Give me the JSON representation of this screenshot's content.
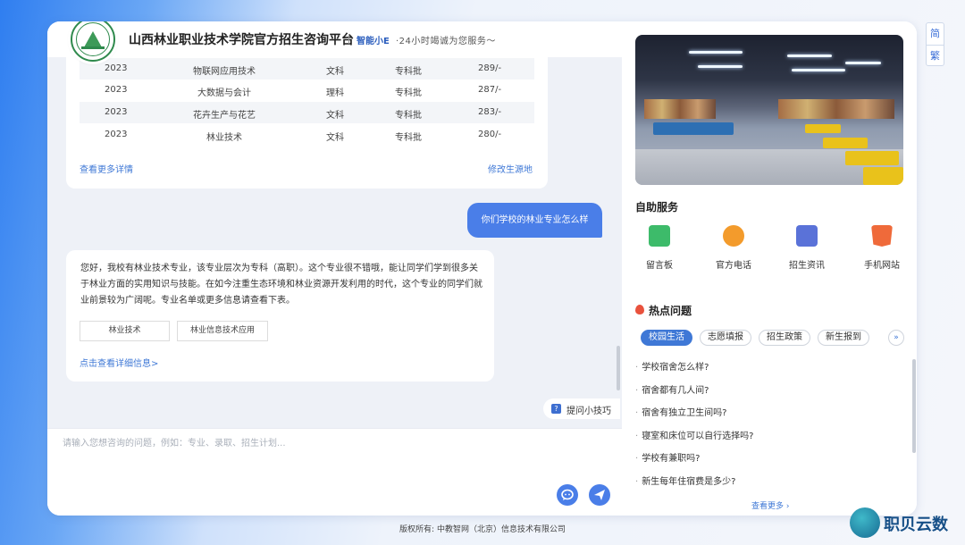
{
  "lang_switch": {
    "simplified": "简",
    "traditional": "繁"
  },
  "header": {
    "title": "山西林业职业技术学院官方招生咨询平台",
    "brand": "智能小E",
    "slogan": "·24小时竭诚为您服务～"
  },
  "table": {
    "rows": [
      {
        "year": "2023",
        "major": "物联网应用技术",
        "category": "文科",
        "batch": "专科批",
        "score": "289/-"
      },
      {
        "year": "2023",
        "major": "大数据与会计",
        "category": "理科",
        "batch": "专科批",
        "score": "287/-"
      },
      {
        "year": "2023",
        "major": "花卉生产与花艺",
        "category": "文科",
        "batch": "专科批",
        "score": "283/-"
      },
      {
        "year": "2023",
        "major": "林业技术",
        "category": "文科",
        "batch": "专科批",
        "score": "280/-"
      }
    ],
    "more_link": "查看更多详情",
    "change_origin_link": "修改生源地"
  },
  "user_message": "你们学校的林业专业怎么样",
  "answer": {
    "text": "您好，我校有林业技术专业，该专业层次为专科（高职）。这个专业很不错哦，能让同学们学到很多关于林业方面的实用知识与技能。在如今注重生态环境和林业资源开发利用的时代，这个专业的同学们就业前景较为广阔呢。专业名单或更多信息请查看下表。",
    "tags": [
      "林业技术",
      "林业信息技术应用"
    ],
    "detail_link": "点击查看详细信息>"
  },
  "tips_button": "提问小技巧",
  "input": {
    "placeholder": "请输入您想咨询的问题，例如：专业、录取、招生计划..."
  },
  "self_service": {
    "title": "自助服务",
    "items": [
      {
        "label": "留言板",
        "icon": "message-board-icon",
        "color": "#3dbb6a"
      },
      {
        "label": "官方电话",
        "icon": "phone-icon",
        "color": "#f39b2c"
      },
      {
        "label": "招生资讯",
        "icon": "news-icon",
        "color": "#5a72d8"
      },
      {
        "label": "手机网站",
        "icon": "html5-icon",
        "color": "#ef6a3a"
      }
    ]
  },
  "hot": {
    "title": "热点问题",
    "tabs": [
      "校园生活",
      "志愿填报",
      "招生政策",
      "新生报到"
    ],
    "active_tab": "校园生活",
    "questions": [
      "学校宿舍怎么样?",
      "宿舍都有几人间?",
      "宿舍有独立卫生间吗?",
      "寝室和床位可以自行选择吗?",
      "学校有兼职吗?",
      "新生每年住宿费是多少?"
    ],
    "more": "查看更多"
  },
  "footer": "版权所有: 中教智网（北京）信息技术有限公司",
  "watermark": "职贝云数"
}
